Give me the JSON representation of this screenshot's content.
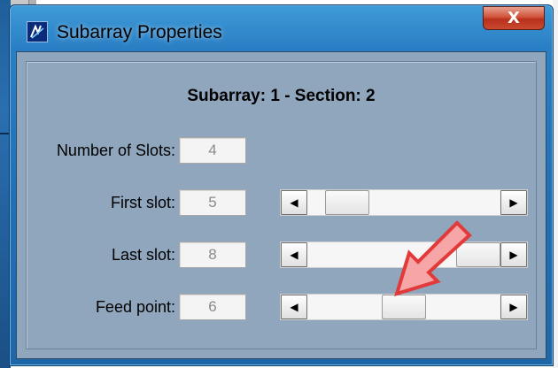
{
  "window": {
    "title": "Subarray Properties",
    "close_glyph": "X",
    "app_icon": "subarray-app-icon"
  },
  "dialog": {
    "heading": "Subarray: 1 - Section: 2",
    "rows": [
      {
        "label": "Number of Slots:",
        "value": "4",
        "has_scrollbar": false
      },
      {
        "label": "First slot:",
        "value": "5",
        "has_scrollbar": true,
        "position": 0.12
      },
      {
        "label": "Last slot:",
        "value": "8",
        "has_scrollbar": true,
        "position": 1.0
      },
      {
        "label": "Feed point:",
        "value": "6",
        "has_scrollbar": true,
        "position": 0.5
      }
    ]
  },
  "scroll_arrows": {
    "left": "◀",
    "right": "▶"
  },
  "colors": {
    "client_background": "#8fa6bd",
    "annotation_arrow": "#e23a3a"
  }
}
